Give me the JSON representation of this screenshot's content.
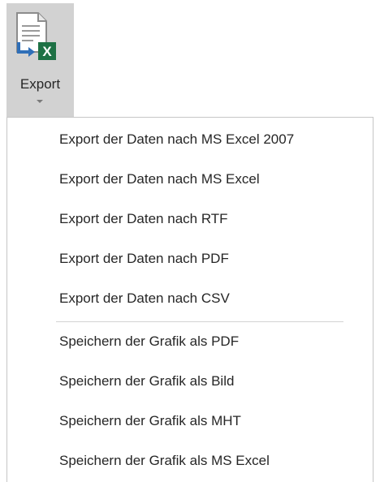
{
  "ribbon": {
    "export_label": "Export",
    "export_icon": "export-excel-icon",
    "accent": "#1e7145"
  },
  "menu": {
    "data_items": [
      {
        "label": "Export der Daten nach MS Excel 2007"
      },
      {
        "label": "Export der Daten nach MS Excel"
      },
      {
        "label": "Export der Daten nach RTF"
      },
      {
        "label": "Export der Daten nach PDF"
      },
      {
        "label": "Export der Daten nach CSV"
      }
    ],
    "graphic_items": [
      {
        "label": "Speichern der Grafik als PDF"
      },
      {
        "label": "Speichern der Grafik als Bild"
      },
      {
        "label": "Speichern der Grafik als MHT"
      },
      {
        "label": "Speichern der Grafik als MS Excel"
      }
    ]
  }
}
